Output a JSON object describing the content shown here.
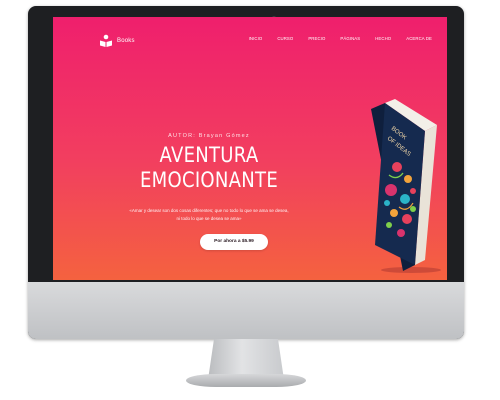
{
  "brand": {
    "name": "Books",
    "icon": "book-reader-icon"
  },
  "nav": {
    "items": [
      "INICIO",
      "CURSO",
      "PRECIO",
      "PÁGINAS",
      "HECHO",
      "ACERCA DE"
    ]
  },
  "hero": {
    "author": "AUTOR: Brayan Gómez",
    "title_line1": "AVENTURA",
    "title_line2": "EMOCIONANTE",
    "quote_line1": "«Amar y desear son dos cosas diferentes; que no todo lo que se ama se desea,",
    "quote_line2": "ni todo lo que se desea se ama»",
    "cta_label": "Por ahora a $5.99"
  },
  "book_cover": {
    "title_line1": "BOOK",
    "title_line2": "OF IDEAS"
  },
  "colors": {
    "accent_top": "#ef1f6d",
    "accent_bottom": "#f4623f",
    "book_cover": "#152a4f"
  }
}
